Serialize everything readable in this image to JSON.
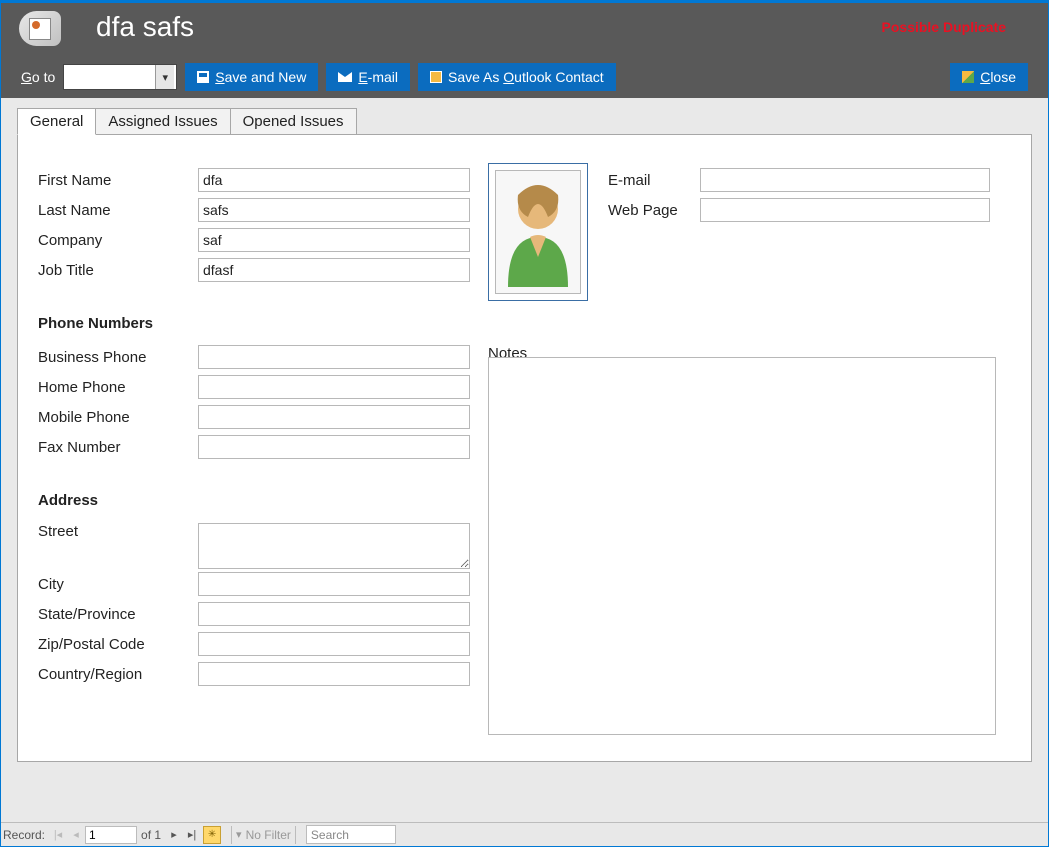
{
  "header": {
    "title": "dfa safs",
    "possible_duplicate": "Possible Duplicate",
    "goto_label_pre": "G",
    "goto_label_post": "o to"
  },
  "toolbar": {
    "save_and_new_pre": "S",
    "save_and_new_post": "ave and New",
    "email_pre": "E",
    "email_post": "-mail",
    "save_outlook_pre": "Save As ",
    "save_outlook_mid": "O",
    "save_outlook_post": "utlook Contact",
    "close_pre": "C",
    "close_post": "lose"
  },
  "tabs": {
    "general": "General",
    "assigned": "Assigned Issues",
    "opened": "Opened Issues"
  },
  "labels": {
    "first_name": "First Name",
    "last_name": "Last Name",
    "company": "Company",
    "job_title": "Job Title",
    "phone_section": "Phone Numbers",
    "business_phone": "Business Phone",
    "home_phone": "Home Phone",
    "mobile_phone": "Mobile Phone",
    "fax_number": "Fax Number",
    "address_section": "Address",
    "street": "Street",
    "city": "City",
    "state": "State/Province",
    "zip": "Zip/Postal Code",
    "country": "Country/Region",
    "email": "E-mail",
    "web_page": "Web Page",
    "notes": "Notes"
  },
  "values": {
    "first_name": "dfa",
    "last_name": "safs",
    "company": "saf",
    "job_title": "dfasf",
    "business_phone": "",
    "home_phone": "",
    "mobile_phone": "",
    "fax_number": "",
    "street": "",
    "city": "",
    "state": "",
    "zip": "",
    "country": "",
    "email": "",
    "web_page": "",
    "notes": ""
  },
  "status": {
    "record_label": "Record:",
    "record_value": "1",
    "of_text": "of 1",
    "no_filter": "No Filter",
    "search_placeholder": "Search"
  }
}
